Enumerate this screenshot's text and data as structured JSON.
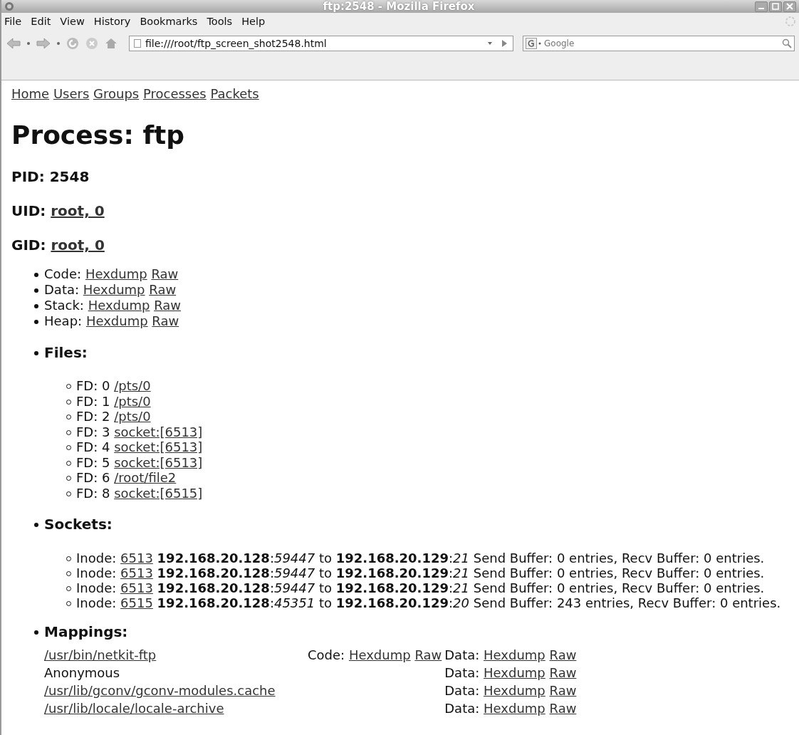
{
  "window": {
    "title": "ftp:2548 - Mozilla Firefox"
  },
  "menu": [
    "File",
    "Edit",
    "View",
    "History",
    "Bookmarks",
    "Tools",
    "Help"
  ],
  "address": {
    "value": "file:///root/ftp_screen_shot2548.html"
  },
  "search": {
    "placeholder": "Google"
  },
  "nav": [
    "Home",
    "Users",
    "Groups",
    "Processes",
    "Packets"
  ],
  "heading": "Process: ftp",
  "pid": {
    "label": "PID:",
    "value": "2548"
  },
  "uid": {
    "label": "UID:",
    "link": "root, 0"
  },
  "gid": {
    "label": "GID:",
    "link": "root, 0"
  },
  "segments": [
    {
      "label": "Code:",
      "links": [
        "Hexdump",
        "Raw"
      ]
    },
    {
      "label": "Data:",
      "links": [
        "Hexdump",
        "Raw"
      ]
    },
    {
      "label": "Stack:",
      "links": [
        "Hexdump",
        "Raw"
      ]
    },
    {
      "label": "Heap:",
      "links": [
        "Hexdump",
        "Raw"
      ]
    }
  ],
  "files": {
    "title": "Files:",
    "items": [
      {
        "label": "FD: 0",
        "link": "/pts/0"
      },
      {
        "label": "FD: 1",
        "link": "/pts/0"
      },
      {
        "label": "FD: 2",
        "link": "/pts/0"
      },
      {
        "label": "FD: 3",
        "link": "socket:[6513]"
      },
      {
        "label": "FD: 4",
        "link": "socket:[6513]"
      },
      {
        "label": "FD: 5",
        "link": "socket:[6513]"
      },
      {
        "label": "FD: 6",
        "link": "/root/file2"
      },
      {
        "label": "FD: 8",
        "link": "socket:[6515]"
      }
    ]
  },
  "sockets": {
    "title": "Sockets:",
    "items": [
      {
        "label": "Inode:",
        "inode": "6513",
        "text": "**192.168.20.128**:*59447* to **192.168.20.129**:*21* Send Buffer: 0 entries, Recv Buffer: 0 entries."
      },
      {
        "label": "Inode:",
        "inode": "6513",
        "text": "**192.168.20.128**:*59447* to **192.168.20.129**:*21* Send Buffer: 0 entries, Recv Buffer: 0 entries."
      },
      {
        "label": "Inode:",
        "inode": "6513",
        "text": "**192.168.20.128**:*59447* to **192.168.20.129**:*21* Send Buffer: 0 entries, Recv Buffer: 0 entries."
      },
      {
        "label": "Inode:",
        "inode": "6515",
        "text": "**192.168.20.128**:*45351* to **192.168.20.129**:*20* Send Buffer: 243 entries, Recv Buffer: 0 entries."
      }
    ]
  },
  "mappings": {
    "title": "Mappings:",
    "rows": [
      {
        "name": "/usr/bin/netkit-ftp",
        "kind": "link",
        "code": {
          "label": "Code:",
          "links": [
            "Hexdump",
            "Raw"
          ]
        },
        "data": {
          "label": "Data:",
          "links": [
            "Hexdump",
            "Raw"
          ]
        }
      },
      {
        "name": "Anonymous",
        "kind": "text",
        "data": {
          "label": "Data:",
          "links": [
            "Hexdump",
            "Raw"
          ]
        }
      },
      {
        "name": "/usr/lib/gconv/gconv-modules.cache",
        "kind": "link",
        "data": {
          "label": "Data:",
          "links": [
            "Hexdump",
            "Raw"
          ]
        }
      },
      {
        "name": "/usr/lib/locale/locale-archive",
        "kind": "link",
        "data": {
          "label": "Data:",
          "links": [
            "Hexdump",
            "Raw"
          ]
        }
      }
    ]
  }
}
